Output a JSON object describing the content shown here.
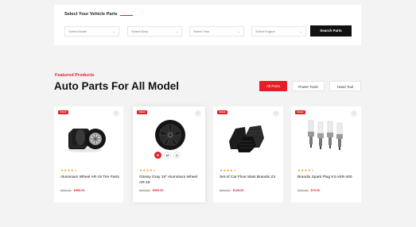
{
  "search": {
    "title": "Select Your Vehicle Parts",
    "selects": [
      "Select Model",
      "Select Body",
      "Select Year",
      "Select Engine"
    ],
    "button_label": "Search Parts"
  },
  "featured": {
    "label": "Featured Products",
    "title": "Auto Parts For All Model"
  },
  "tabs": [
    {
      "label": "All Parts",
      "active": true
    },
    {
      "label": "Power Tools",
      "active": false
    },
    {
      "label": "Hand Tool",
      "active": false
    }
  ],
  "products": [
    {
      "badge": "SALE",
      "name": "Aluminium Wheel AR-19 Tire Parts",
      "old_price": "$790.00",
      "new_price": "$450.00",
      "rating": 4,
      "image_icon": "tires-icon"
    },
    {
      "badge": "SALE",
      "name": "Glossy Gray 19\" Aluminium Wheel AR-19",
      "old_price": "$420.00",
      "new_price": "$360.00",
      "rating": 4,
      "image_icon": "alloy-wheel-icon"
    },
    {
      "badge": "SALE",
      "name": "Set of Car Floor Mats Brandix Z4",
      "old_price": "$200.00",
      "new_price": "$128.00",
      "rating": 4,
      "image_icon": "floor-mats-icon"
    },
    {
      "badge": "SALE",
      "name": "Brandix Spark Plug Kit ASR-400",
      "old_price": "$100.00",
      "new_price": "$70.00",
      "rating": 4,
      "image_icon": "spark-plug-icon"
    }
  ],
  "colors": {
    "accent": "#e41e26",
    "dark": "#111111",
    "star": "#f2a21b"
  }
}
